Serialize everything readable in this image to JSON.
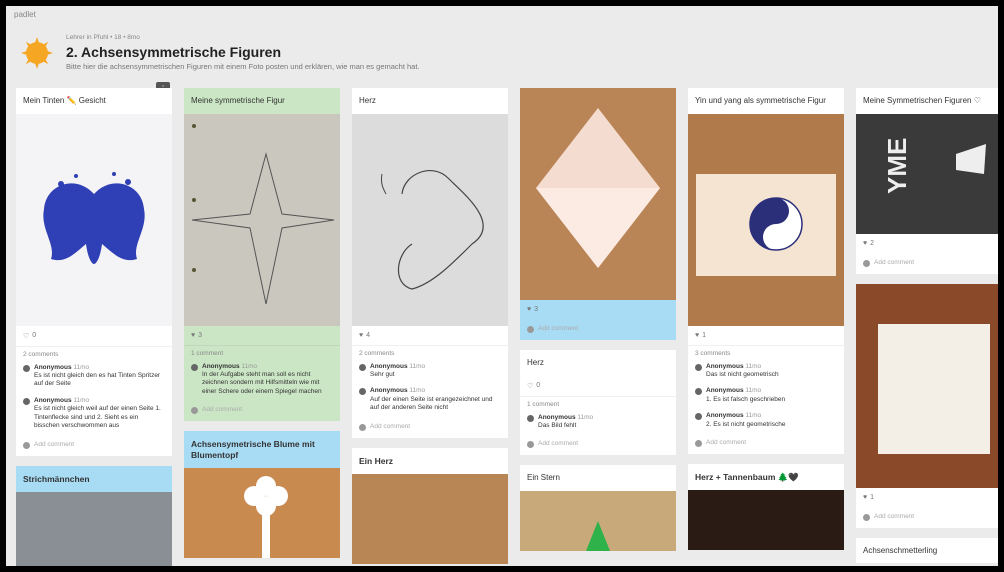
{
  "app": {
    "brand": "padlet"
  },
  "header": {
    "meta": "Lehrer in Pfuhl • 18 • 8mo",
    "title": "2. Achsensymmetrische Figuren",
    "subtitle": "Bitte hier die achsensymmetrischen Figuren mit einem Foto posten und erklären, wie man es gemacht hat.",
    "menu_glyph": "⋮"
  },
  "colors": {
    "accent": "#f5a623",
    "green_card": "#cbe6c5",
    "blue_card": "#a8dcf5"
  },
  "icons": {
    "heart": "heart-icon",
    "avatar": "avatar-icon"
  },
  "common": {
    "add_comment": "Add comment"
  },
  "col1": {
    "card1": {
      "title": "Mein Tinten ✏️ Gesicht",
      "likes": "0",
      "comments_count": "2 comments",
      "comments": [
        {
          "author": "Anonymous",
          "time": "11mo",
          "text": "Es ist nicht gleich den es hat Tinten Spritzer auf der Seite"
        },
        {
          "author": "Anonymous",
          "time": "11mo",
          "text": "Es ist nicht gleich weil auf der einen Seite 1. Tintenflecke sind und 2. Sieht es ein bisschen verschwommen aus"
        }
      ]
    },
    "card2": {
      "title": "Strichmännchen"
    }
  },
  "col2": {
    "card1": {
      "title": "Meine symmetrische Figur",
      "likes": "3",
      "comments_count": "1 comment",
      "comments": [
        {
          "author": "Anonymous",
          "time": "11mo",
          "text": "In der Aufgabe steht man soll es nicht zeichnen sondern mit Hilfsmitteln wie mit einer Schere oder einem Spiegel machen"
        }
      ]
    },
    "card2": {
      "title": "Achsensymetrische Blume mit Blumentopf"
    }
  },
  "col3": {
    "card1": {
      "title": "Herz",
      "likes": "4",
      "comments_count": "2 comments",
      "comments": [
        {
          "author": "Anonymous",
          "time": "11mo",
          "text": "Sehr gut"
        },
        {
          "author": "Anonymous",
          "time": "11mo",
          "text": "Auf der einen Seite ist erangezeichnet und auf der anderen Seite nicht"
        }
      ]
    },
    "card2": {
      "title": "Ein Herz"
    }
  },
  "col4": {
    "card1": {
      "likes": "3"
    },
    "card2": {
      "title": "Herz",
      "likes": "0",
      "comments_count": "1 comment",
      "comments": [
        {
          "author": "Anonymous",
          "time": "11mo",
          "text": "Das Bild fehlt"
        }
      ]
    },
    "card3": {
      "title": "Ein Stern"
    }
  },
  "col5": {
    "card1": {
      "title": "Yin und yang als symmetrische Figur",
      "likes": "1",
      "comments_count": "3 comments",
      "comments": [
        {
          "author": "Anonymous",
          "time": "11mo",
          "text": "Das ist nicht geometrisch"
        },
        {
          "author": "Anonymous",
          "time": "11mo",
          "text": "1. Es ist falsch geschrieben"
        },
        {
          "author": "Anonymous",
          "time": "11mo",
          "text": "2. Es ist nicht geometrische"
        }
      ]
    },
    "card2": {
      "title": "Herz + Tannenbaum 🌲🖤"
    }
  },
  "col6": {
    "card1": {
      "title": "Meine Symmetrischen Figuren ♡",
      "likes": "2"
    },
    "card2": {
      "likes": "1"
    },
    "card3": {
      "title": "Achsenschmetterling"
    }
  }
}
